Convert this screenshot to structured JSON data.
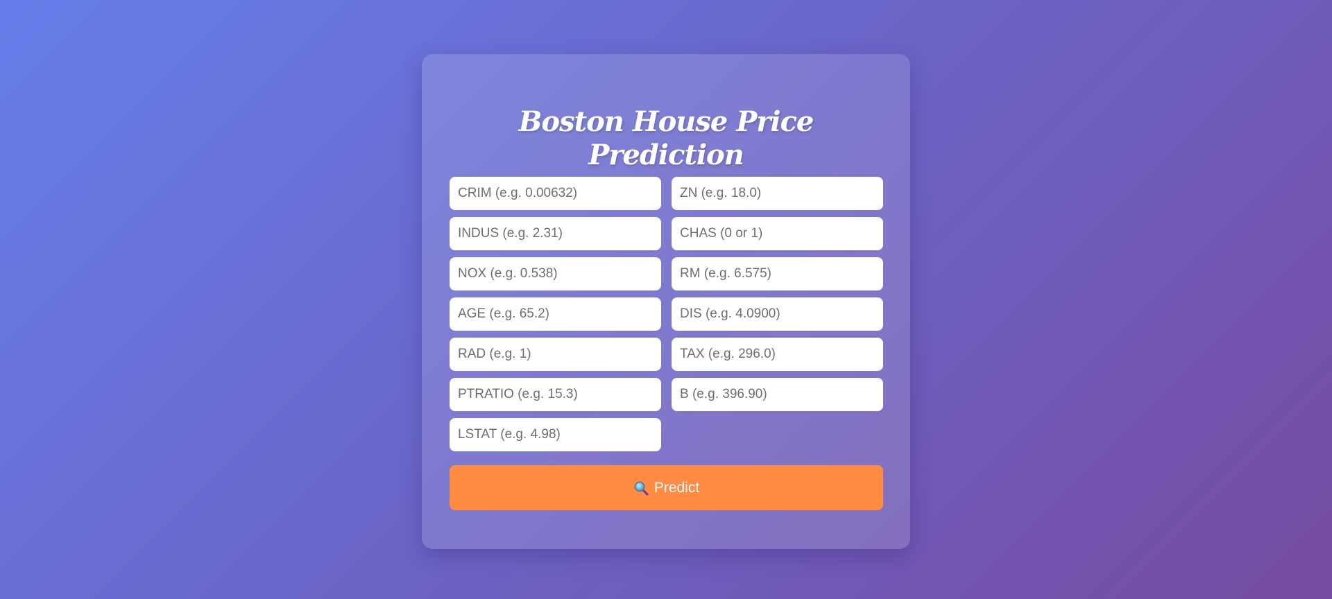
{
  "title": "Boston House Price Prediction",
  "form": {
    "fields": [
      {
        "placeholder": "CRIM (e.g. 0.00632)",
        "value": ""
      },
      {
        "placeholder": "ZN (e.g. 18.0)",
        "value": ""
      },
      {
        "placeholder": "INDUS (e.g. 2.31)",
        "value": ""
      },
      {
        "placeholder": "CHAS (0 or 1)",
        "value": ""
      },
      {
        "placeholder": "NOX (e.g. 0.538)",
        "value": ""
      },
      {
        "placeholder": "RM (e.g. 6.575)",
        "value": ""
      },
      {
        "placeholder": "AGE (e.g. 65.2)",
        "value": ""
      },
      {
        "placeholder": "DIS (e.g. 4.0900)",
        "value": ""
      },
      {
        "placeholder": "RAD (e.g. 1)",
        "value": ""
      },
      {
        "placeholder": "TAX (e.g. 296.0)",
        "value": ""
      },
      {
        "placeholder": "PTRATIO (e.g. 15.3)",
        "value": ""
      },
      {
        "placeholder": "B (e.g. 396.90)",
        "value": ""
      },
      {
        "placeholder": "LSTAT (e.g. 4.98)",
        "value": ""
      }
    ],
    "submit": {
      "icon": "magnifying-glass-icon",
      "label": "Predict"
    }
  },
  "colors": {
    "background_start": "#667eea",
    "background_end": "#764ba2",
    "button": "#ff8c42",
    "title": "#ffffff"
  }
}
